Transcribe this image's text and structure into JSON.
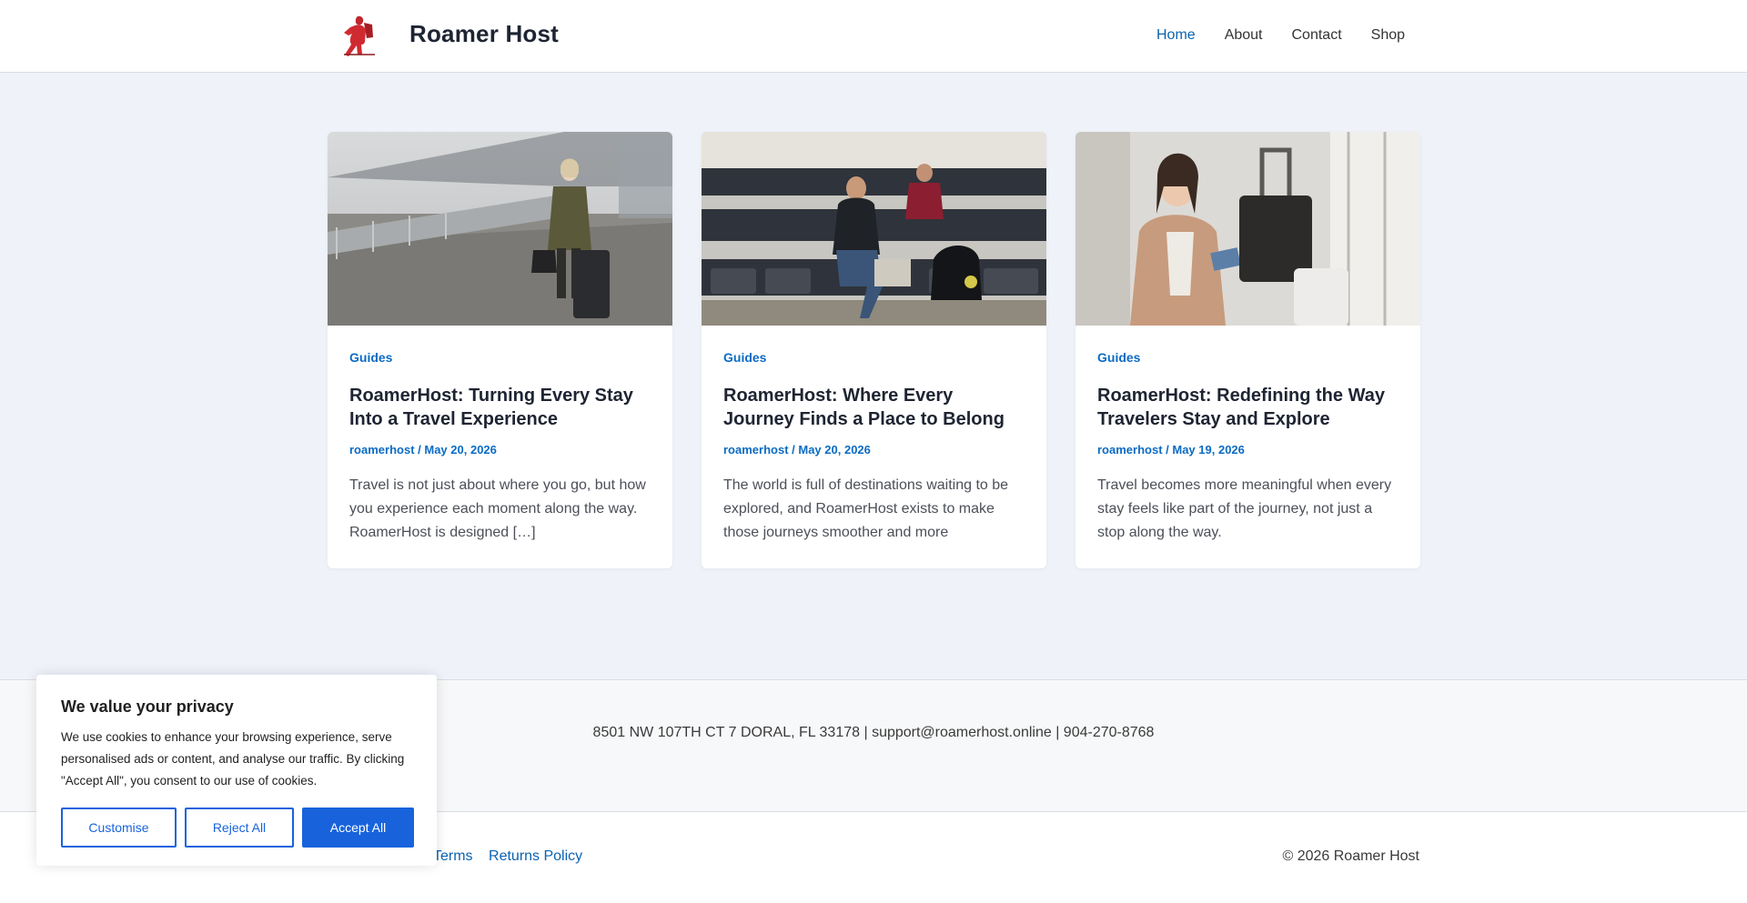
{
  "site": {
    "title": "Roamer Host"
  },
  "nav": {
    "items": [
      "Home",
      "About",
      "Contact",
      "Shop"
    ],
    "active": "Home"
  },
  "posts": [
    {
      "category": "Guides",
      "title": "RoamerHost: Turning Every Stay Into a Travel Experience",
      "author": "roamerhost",
      "separator": " / ",
      "date": "May 20, 2026",
      "excerpt": "Travel is not just about where you go, but how you experience each moment along the way. RoamerHost is designed […]"
    },
    {
      "category": "Guides",
      "title": "RoamerHost: Where Every Journey Finds a Place to Belong",
      "author": "roamerhost",
      "separator": " / ",
      "date": "May 20, 2026",
      "excerpt": "The world is full of destinations waiting to be explored, and RoamerHost exists to make those journeys smoother and more"
    },
    {
      "category": "Guides",
      "title": "RoamerHost: Redefining the Way Travelers Stay and Explore",
      "author": "roamerhost",
      "separator": " / ",
      "date": "May 19, 2026",
      "excerpt": "Travel becomes more meaningful when every stay feels like part of the journey, not just a stop along the way."
    }
  ],
  "footer": {
    "address": "8501 NW 107TH CT 7 DORAL, FL 33178 | support@roamerhost.online | 904-270-8768",
    "links": [
      "Terms",
      "Returns Policy"
    ],
    "copyright": "© 2026 Roamer Host"
  },
  "cookie": {
    "title": "We value your privacy",
    "text": "We use cookies to enhance your browsing experience, serve personalised ads or content, and analyse our traffic. By clicking \"Accept All\", you consent to our use of cookies.",
    "customise": "Customise",
    "reject": "Reject All",
    "accept": "Accept All"
  },
  "colors": {
    "accent": "#0b63b0",
    "cookie_button": "#1863dc",
    "page_background": "#eff3f9"
  }
}
